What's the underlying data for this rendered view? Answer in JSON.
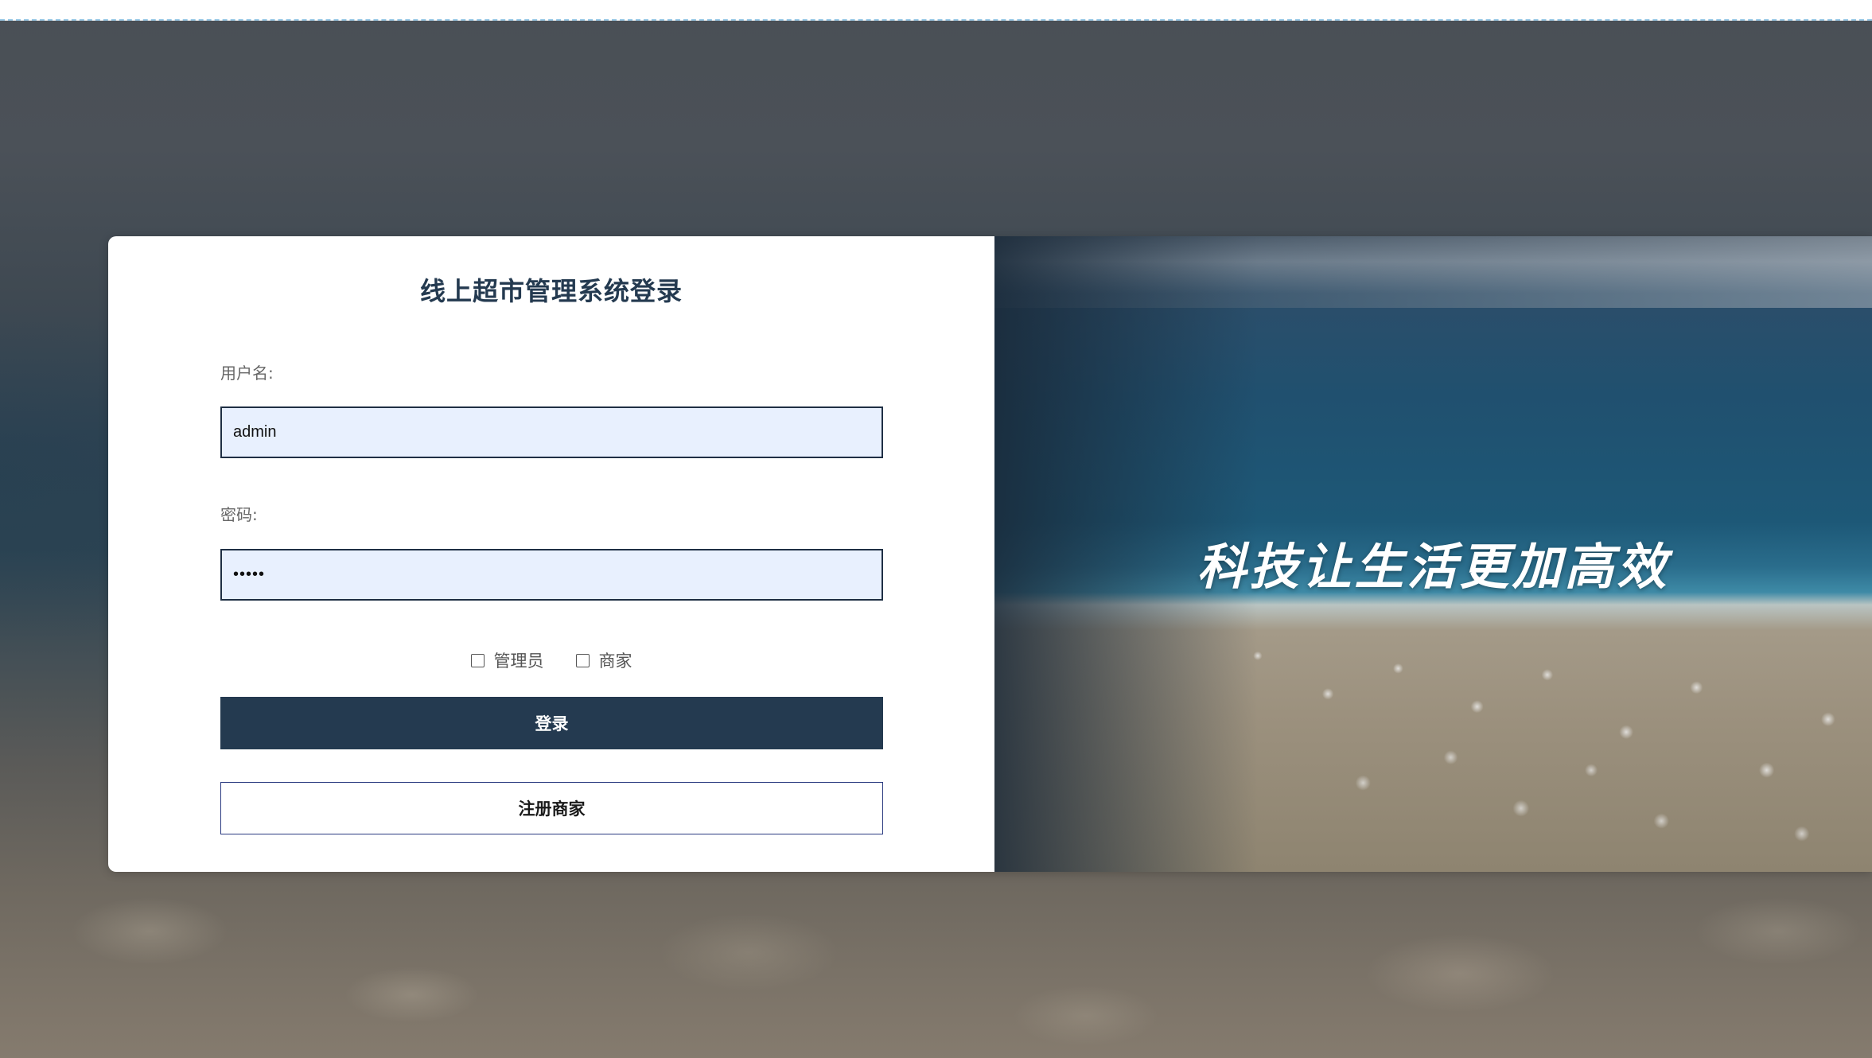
{
  "login": {
    "title": "线上超市管理系统登录",
    "username_label": "用户名:",
    "username_value": "admin",
    "password_label": "密码:",
    "password_value": "•••••",
    "roles": [
      {
        "label": "管理员",
        "checked": false
      },
      {
        "label": "商家",
        "checked": false
      }
    ],
    "login_button": "登录",
    "register_button": "注册商家"
  },
  "banner": {
    "slogan": "科技让生活更加高效"
  },
  "colors": {
    "primary": "#243a50",
    "input_bg": "#e8f0fe",
    "register_border": "#2a3a80"
  },
  "icons": [
    "checkbox-icon"
  ]
}
